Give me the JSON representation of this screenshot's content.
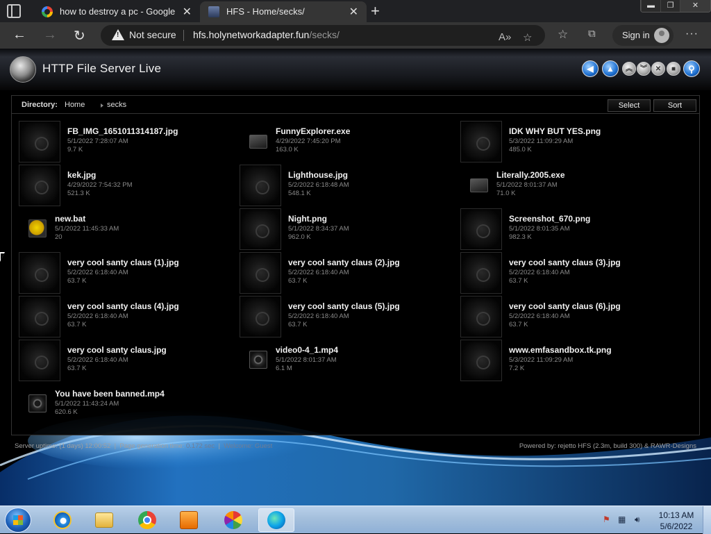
{
  "browser": {
    "tabs": [
      {
        "title": "how to destroy a pc - Google Se"
      },
      {
        "title": "HFS - Home/secks/"
      }
    ],
    "security_label": "Not secure",
    "url_host": "hfs.holynetworkadapter.fun",
    "url_path": "/secks/",
    "sign_in_label": "Sign in"
  },
  "hfs": {
    "title": "HTTP File Server Live",
    "directory_label": "Directory:",
    "breadcrumb": [
      "Home",
      "secks"
    ],
    "select_label": "Select",
    "sort_label": "Sort",
    "files": [
      {
        "name": "FB_IMG_1651011314187.jpg",
        "date": "5/1/2022 7:28:07 AM",
        "size": "9.7 K",
        "type": "image"
      },
      {
        "name": "FunnyExplorer.exe",
        "date": "4/29/2022 7:45:20 PM",
        "size": "163.0 K",
        "type": "exe"
      },
      {
        "name": "IDK WHY BUT YES.png",
        "date": "5/3/2022 11:09:29 AM",
        "size": "485.0 K",
        "type": "image"
      },
      {
        "name": "kek.jpg",
        "date": "4/29/2022 7:54:32 PM",
        "size": "521.3 K",
        "type": "image"
      },
      {
        "name": "Lighthouse.jpg",
        "date": "5/2/2022 6:18:48 AM",
        "size": "548.1 K",
        "type": "image"
      },
      {
        "name": "Literally.2005.exe",
        "date": "5/1/2022 8:01:37 AM",
        "size": "71.0 K",
        "type": "exe"
      },
      {
        "name": "new.bat",
        "date": "5/1/2022 11:45:33 AM",
        "size": "20",
        "type": "bat"
      },
      {
        "name": "Night.png",
        "date": "5/1/2022 8:34:37 AM",
        "size": "962.0 K",
        "type": "image"
      },
      {
        "name": "Screenshot_670.png",
        "date": "5/1/2022 8:01:35 AM",
        "size": "982.3 K",
        "type": "image"
      },
      {
        "name": "very cool santy claus (1).jpg",
        "date": "5/2/2022 6:18:40 AM",
        "size": "63.7 K",
        "type": "image"
      },
      {
        "name": "very cool santy claus (2).jpg",
        "date": "5/2/2022 6:18:40 AM",
        "size": "63.7 K",
        "type": "image"
      },
      {
        "name": "very cool santy claus (3).jpg",
        "date": "5/2/2022 6:18:40 AM",
        "size": "63.7 K",
        "type": "image"
      },
      {
        "name": "very cool santy claus (4).jpg",
        "date": "5/2/2022 6:18:40 AM",
        "size": "63.7 K",
        "type": "image"
      },
      {
        "name": "very cool santy claus (5).jpg",
        "date": "5/2/2022 6:18:40 AM",
        "size": "63.7 K",
        "type": "image"
      },
      {
        "name": "very cool santy claus (6).jpg",
        "date": "5/2/2022 6:18:40 AM",
        "size": "63.7 K",
        "type": "image"
      },
      {
        "name": "very cool santy claus.jpg",
        "date": "5/2/2022 6:18:40 AM",
        "size": "63.7 K",
        "type": "image"
      },
      {
        "name": "video0-4_1.mp4",
        "date": "5/1/2022 8:01:37 AM",
        "size": "6.1 M",
        "type": "mp4"
      },
      {
        "name": "www.emfasandbox.tk.png",
        "date": "5/3/2022 11:09:29 AM",
        "size": "7.2 K",
        "type": "image"
      },
      {
        "name": "You have been banned.mp4",
        "date": "5/1/2022 11:43:24 AM",
        "size": "620.6 K",
        "type": "mp4"
      }
    ],
    "footer": {
      "uptime_label": "Server uptime:",
      "uptime_value": "(1 days) 12:00:52",
      "gen_label": "Page generation time:",
      "gen_value": "0.172 sec",
      "welcome_label": "Welcome:",
      "welcome_value": "Guest",
      "powered": "Powered by: rejetto HFS (2.3m, build 300) & RAWR-Designs"
    }
  },
  "taskbar": {
    "time": "10:13 AM",
    "date": "5/6/2022"
  },
  "colors": {
    "accent": "#1d6fd0",
    "wave": "#2a8be0",
    "page_bg": "#000000"
  },
  "icons": [
    "tab-actions-icon",
    "google-icon",
    "hfs-icon",
    "close-icon",
    "plus-icon",
    "back-icon",
    "forward-icon",
    "refresh-icon",
    "warning-icon",
    "read-aloud-icon",
    "add-favorite-icon",
    "favorites-icon",
    "collections-icon",
    "more-icon",
    "hfs-logo-icon",
    "arrow-left-icon",
    "home-icon",
    "collapse-icon",
    "expand-icon",
    "close-icon",
    "lock-icon",
    "search-icon",
    "image-thumb-icon",
    "exe-icon",
    "bat-icon",
    "video-icon",
    "start-icon",
    "ie-icon",
    "explorer-icon",
    "chrome-icon",
    "media-icon",
    "pinwheel-icon",
    "edge-icon",
    "flag-icon",
    "network-icon",
    "volume-icon"
  ]
}
